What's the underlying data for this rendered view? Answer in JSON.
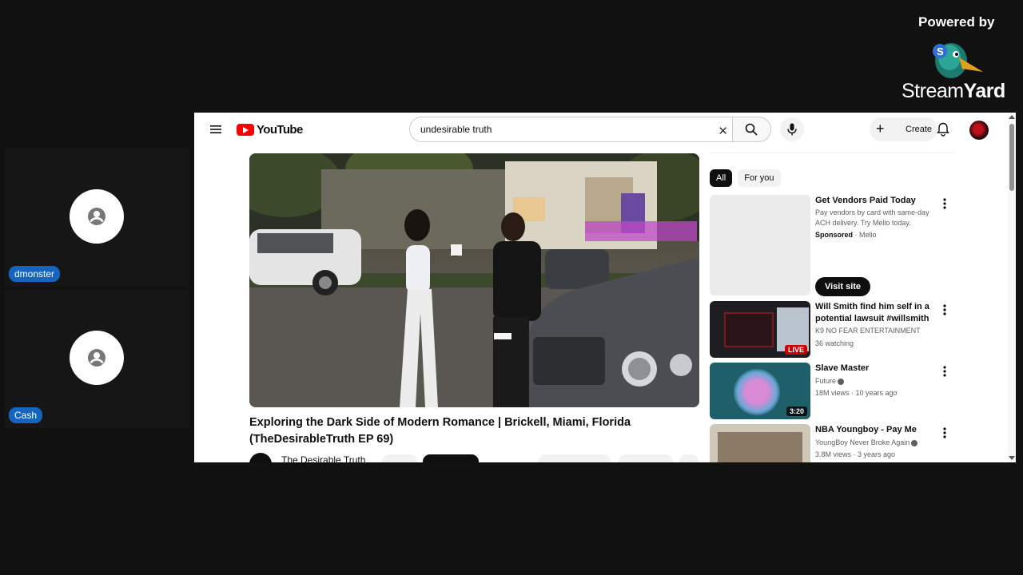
{
  "branding": {
    "powered_by": "Powered by",
    "brand_name_light": "Stream",
    "brand_name_bold": "Yard",
    "accent": "#1565c0"
  },
  "participants": [
    {
      "name": "dmonster"
    },
    {
      "name": "Cash"
    }
  ],
  "youtube": {
    "logo_text": "YouTube",
    "search_value": "undesirable truth",
    "create_label": "Create",
    "video": {
      "title": "Exploring the Dark Side of Modern Romance | Brickell, Miami, Florida (TheDesirableTruth EP 69)",
      "channel": "The Desirable Truth"
    },
    "chips": [
      "All",
      "For you"
    ],
    "sidebar": [
      {
        "title": "Get Vendors Paid Today",
        "desc": "Pay vendors by card with same-day ACH delivery. Try Melio today.",
        "sponsored": "Sponsored",
        "advertiser": "Melio",
        "cta": "Visit site"
      },
      {
        "title": "Will Smith find him self in a potential lawsuit #willsmith",
        "channel": "K9 NO FEAR ENTERTAINMENT",
        "meta": "36 watching",
        "badge": "LIVE"
      },
      {
        "title": "Slave Master",
        "channel": "Future",
        "meta": "18M views · 10 years ago",
        "badge": "3:20"
      },
      {
        "title": "NBA Youngboy - Pay Me",
        "channel": "YoungBoy Never Broke Again",
        "meta": "3.8M views · 3 years ago"
      }
    ]
  }
}
